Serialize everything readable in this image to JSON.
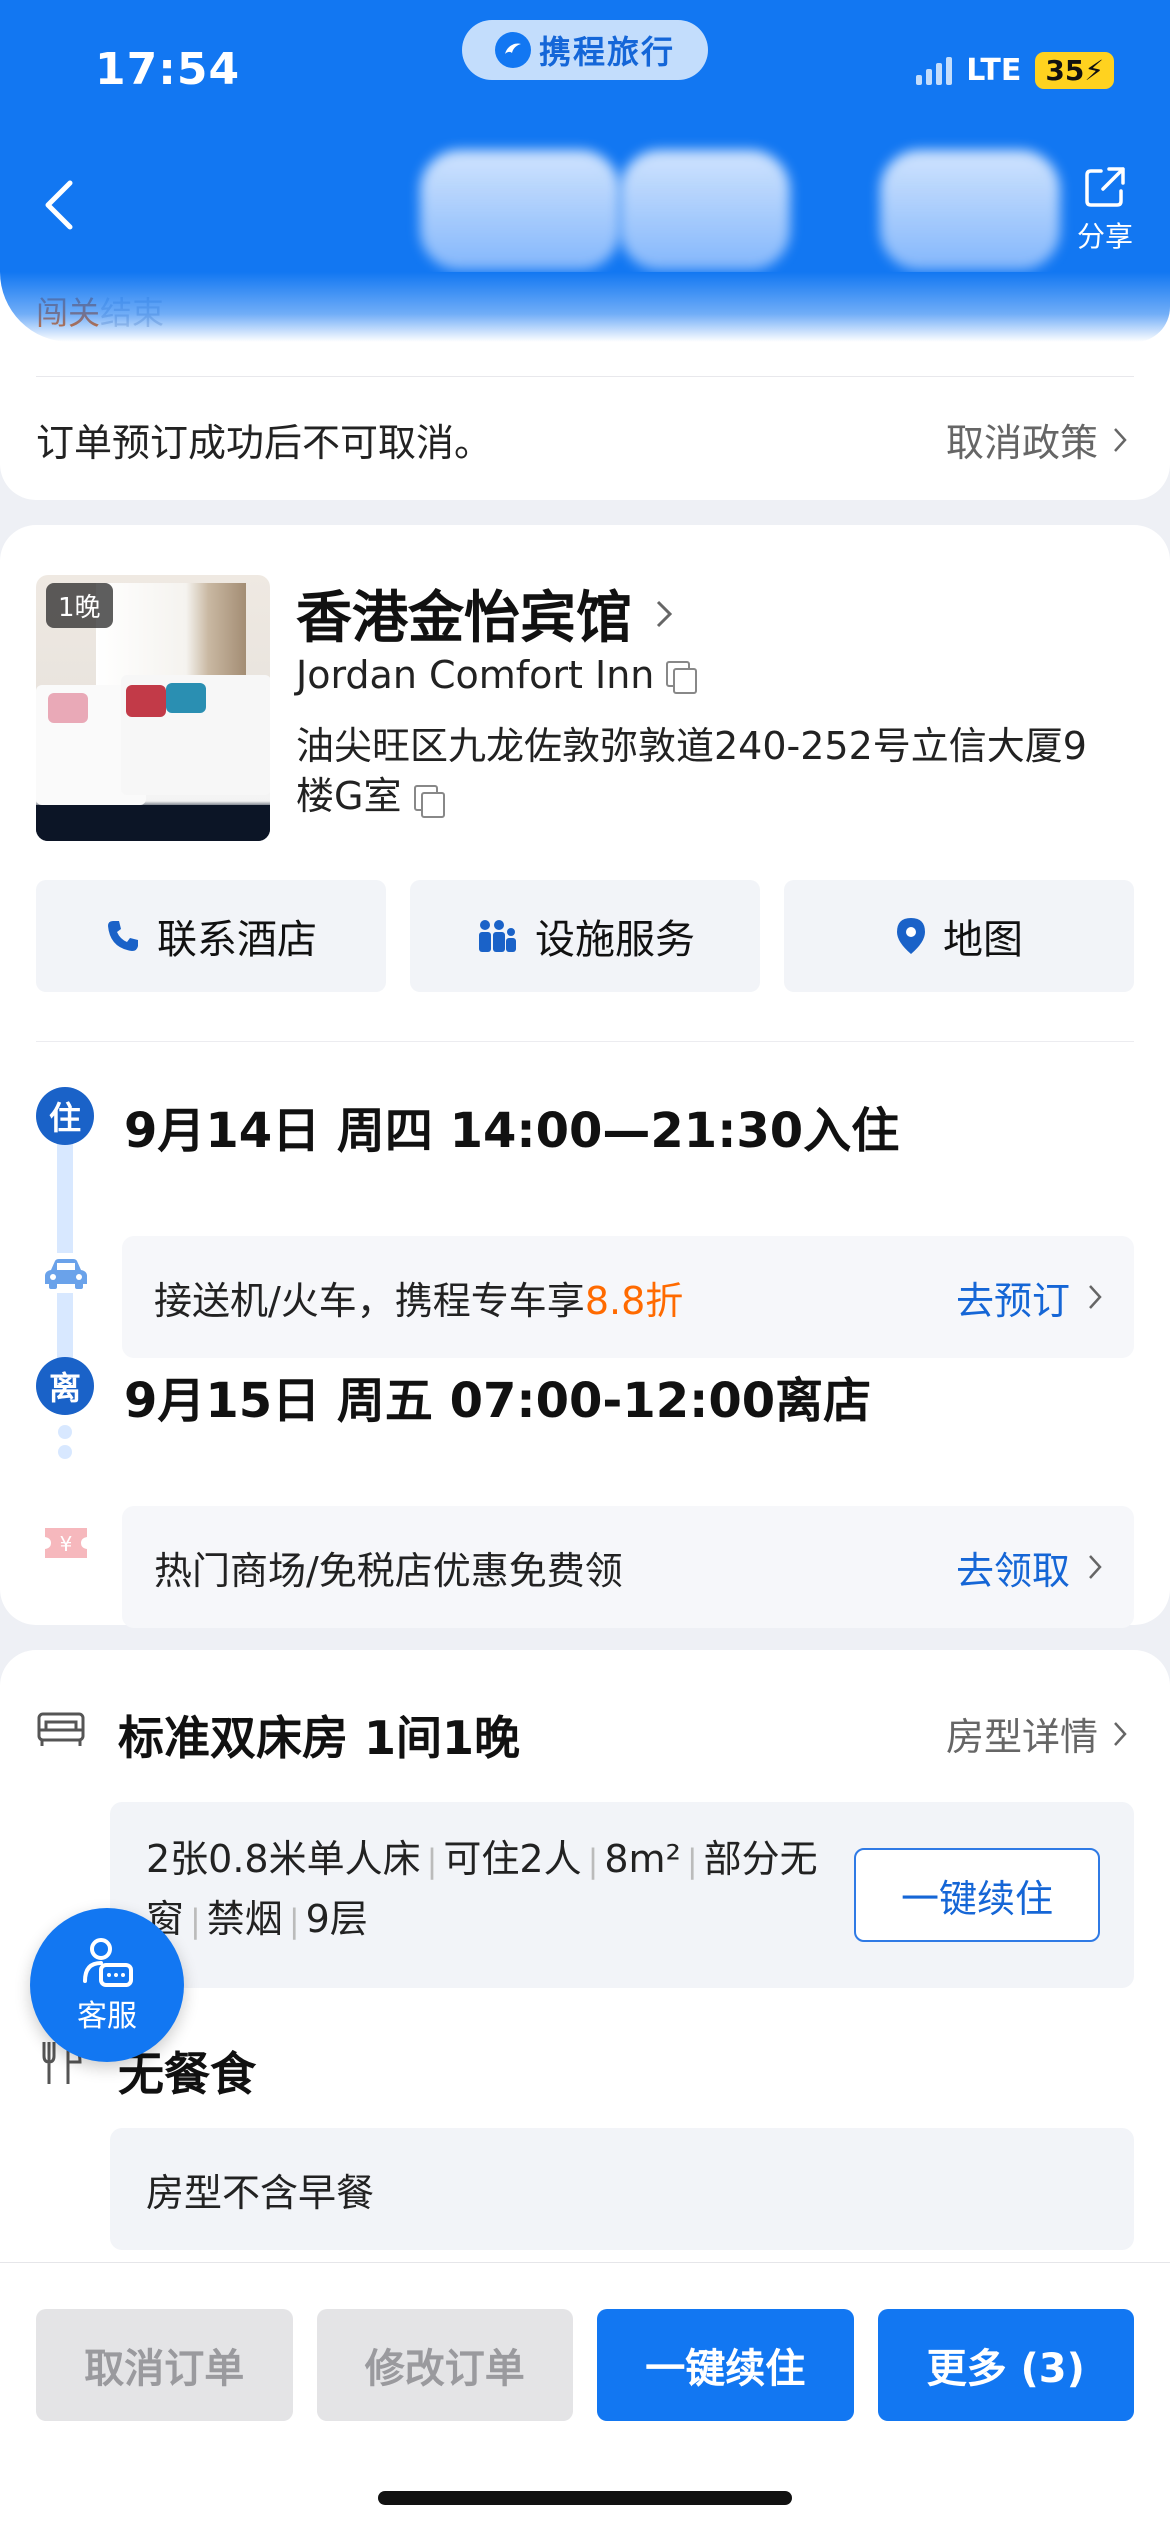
{
  "status_bar": {
    "time": "17:54",
    "network": "LTE",
    "battery": "35"
  },
  "brand": {
    "name": "携程旅行"
  },
  "header": {
    "share_label": "分享"
  },
  "order_status": {
    "part1": "闯关",
    "part2": "结束"
  },
  "cancel": {
    "text": "订单预订成功后不可取消。",
    "policy_label": "取消政策"
  },
  "hotel": {
    "nights_badge": "1晚",
    "name_cn": "香港金怡宾馆",
    "name_en": "Jordan Comfort Inn",
    "address": "油尖旺区九龙佐敦弥敦道240-252号立信大厦9楼G室"
  },
  "hotel_actions": {
    "contact": "联系酒店",
    "facilities": "设施服务",
    "map": "地图"
  },
  "checkin": {
    "badge": "住",
    "text": "9月14日  周四  14:00—21:30入住"
  },
  "transfer_promo": {
    "text": "接送机/火车，携程专车享",
    "highlight": "8.8折",
    "link": "去预订"
  },
  "checkout": {
    "badge": "离",
    "text": "9月15日  周五  07:00-12:00离店"
  },
  "shopping_promo": {
    "text": "热门商场/免税店优惠免费领",
    "link": "去领取"
  },
  "room": {
    "title": "标准双床房  1间1晚",
    "detail_link": "房型详情",
    "features": [
      "2张0.8米单人床",
      "可住2人",
      "8m²",
      "部分无窗",
      "禁烟",
      "9层"
    ],
    "renew_label": "一键续住"
  },
  "meal": {
    "title": "无餐食",
    "note": "房型不含早餐"
  },
  "customer_service": {
    "label": "客服"
  },
  "bottom_actions": {
    "cancel": "取消订单",
    "modify": "修改订单",
    "renew": "一键续住",
    "more": "更多 (3)"
  },
  "colors": {
    "brand_blue": "#1277f2",
    "link_blue": "#1566d6",
    "orange": "#ff6a00"
  }
}
